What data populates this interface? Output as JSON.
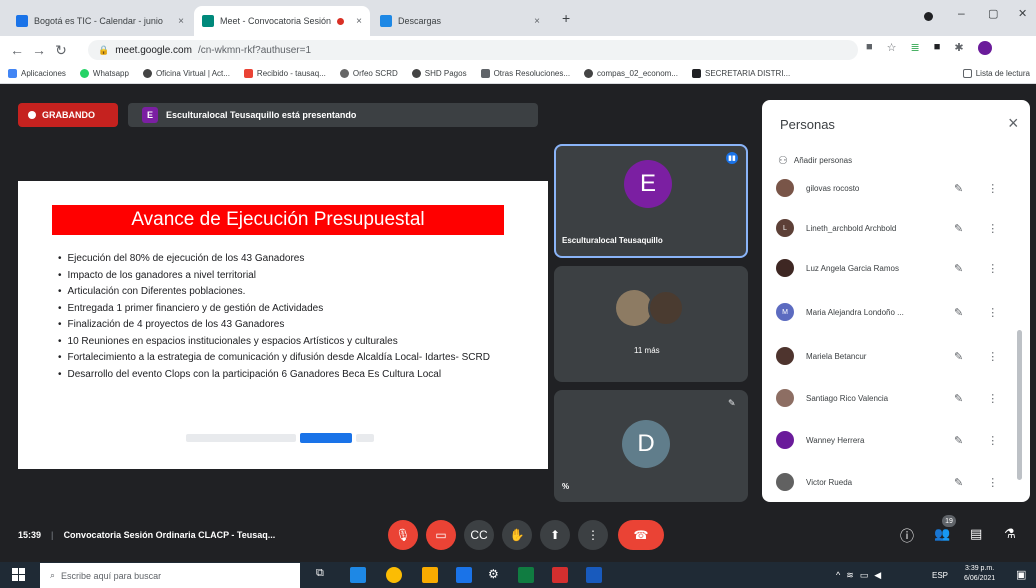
{
  "browser": {
    "tabs": [
      {
        "label": "Bogotá es TIC - Calendar - junio",
        "close": "×"
      },
      {
        "label": "Meet - Convocatoria Sesión",
        "close": "×"
      },
      {
        "label": "Descargas",
        "close": "×"
      }
    ],
    "new_tab": "+",
    "window": {
      "min": "–",
      "max": "▢",
      "close": "✕"
    },
    "url_host": "meet.google.com",
    "url_rest": "/cn-wkmn-rkf?authuser=1",
    "bookmarks": [
      "Aplicaciones",
      "Whatsapp",
      "Oficina Virtual | Act...",
      "Recibido - tausaq...",
      "Orfeo SCRD",
      "SHD Pagos",
      "Otras Resoluciones...",
      "compas_02_econom...",
      "SECRETARIA DISTRI..."
    ],
    "reading_list": "Lista de lectura",
    "colors": {
      "tabstrip": "#dee1e6"
    }
  },
  "meet": {
    "recording_label": "GRABANDO",
    "presenter_initial": "E",
    "presenting_text": "Esculturalocal Teusaquillo está presentando",
    "slide": {
      "title": "Avance de Ejecución Presupuestal",
      "bullets": [
        "Ejecución del 80% de ejecución de los 43 Ganadores",
        "Impacto de los ganadores a nivel territorial",
        "Articulación con Diferentes poblaciones.",
        "Entregada 1 primer financiero y de gestión de Actividades",
        "Finalización de 4 proyectos de los 43 Ganadores",
        " 10 Reuniones en espacios institucionales y espacios Artísticos y culturales",
        "Fortalecimiento a la estrategia de comunicación y difusión desde Alcaldía Local- Idartes- SCRD",
        "Desarrollo del evento Clops con la  participación 6 Ganadores Beca Es Cultura Local"
      ],
      "accent_color": "#ff0000"
    },
    "tiles": {
      "main_initial": "E",
      "main_name": "Esculturalocal Teusaquillo",
      "more_label": "11 más",
      "d_initial": "D",
      "d_name": "%"
    },
    "time": "15:39",
    "meeting_title": "Convocatoria Sesión Ordinaria CLACP - Teusaq...",
    "participant_count": "19"
  },
  "people_panel": {
    "title": "Personas",
    "close": "×",
    "add_people": "Añadir personas",
    "participants": [
      {
        "name": "gilovas rocosto",
        "avatar_color": "#795548",
        "initial": ""
      },
      {
        "name": "Lineth_archbold Archbold",
        "avatar_color": "#5d4037",
        "initial": "L"
      },
      {
        "name": "Luz Angela Garcia Ramos",
        "avatar_color": "#3e2723",
        "initial": ""
      },
      {
        "name": "Maria Alejandra Londoño ...",
        "avatar_color": "#5c6bc0",
        "initial": "M"
      },
      {
        "name": "Mariela Betancur",
        "avatar_color": "#4e342e",
        "initial": ""
      },
      {
        "name": "Santiago Rico Valencia",
        "avatar_color": "#8d6e63",
        "initial": ""
      },
      {
        "name": "Wanney Herrera",
        "avatar_color": "#6a1b9a",
        "initial": ""
      },
      {
        "name": "Victor Rueda",
        "avatar_color": "#616161",
        "initial": ""
      }
    ]
  },
  "taskbar": {
    "search_placeholder": "Escribe aquí para buscar",
    "lang": "ESP",
    "clock_time": "3:39 p.m.",
    "clock_date": "6/06/2021"
  }
}
